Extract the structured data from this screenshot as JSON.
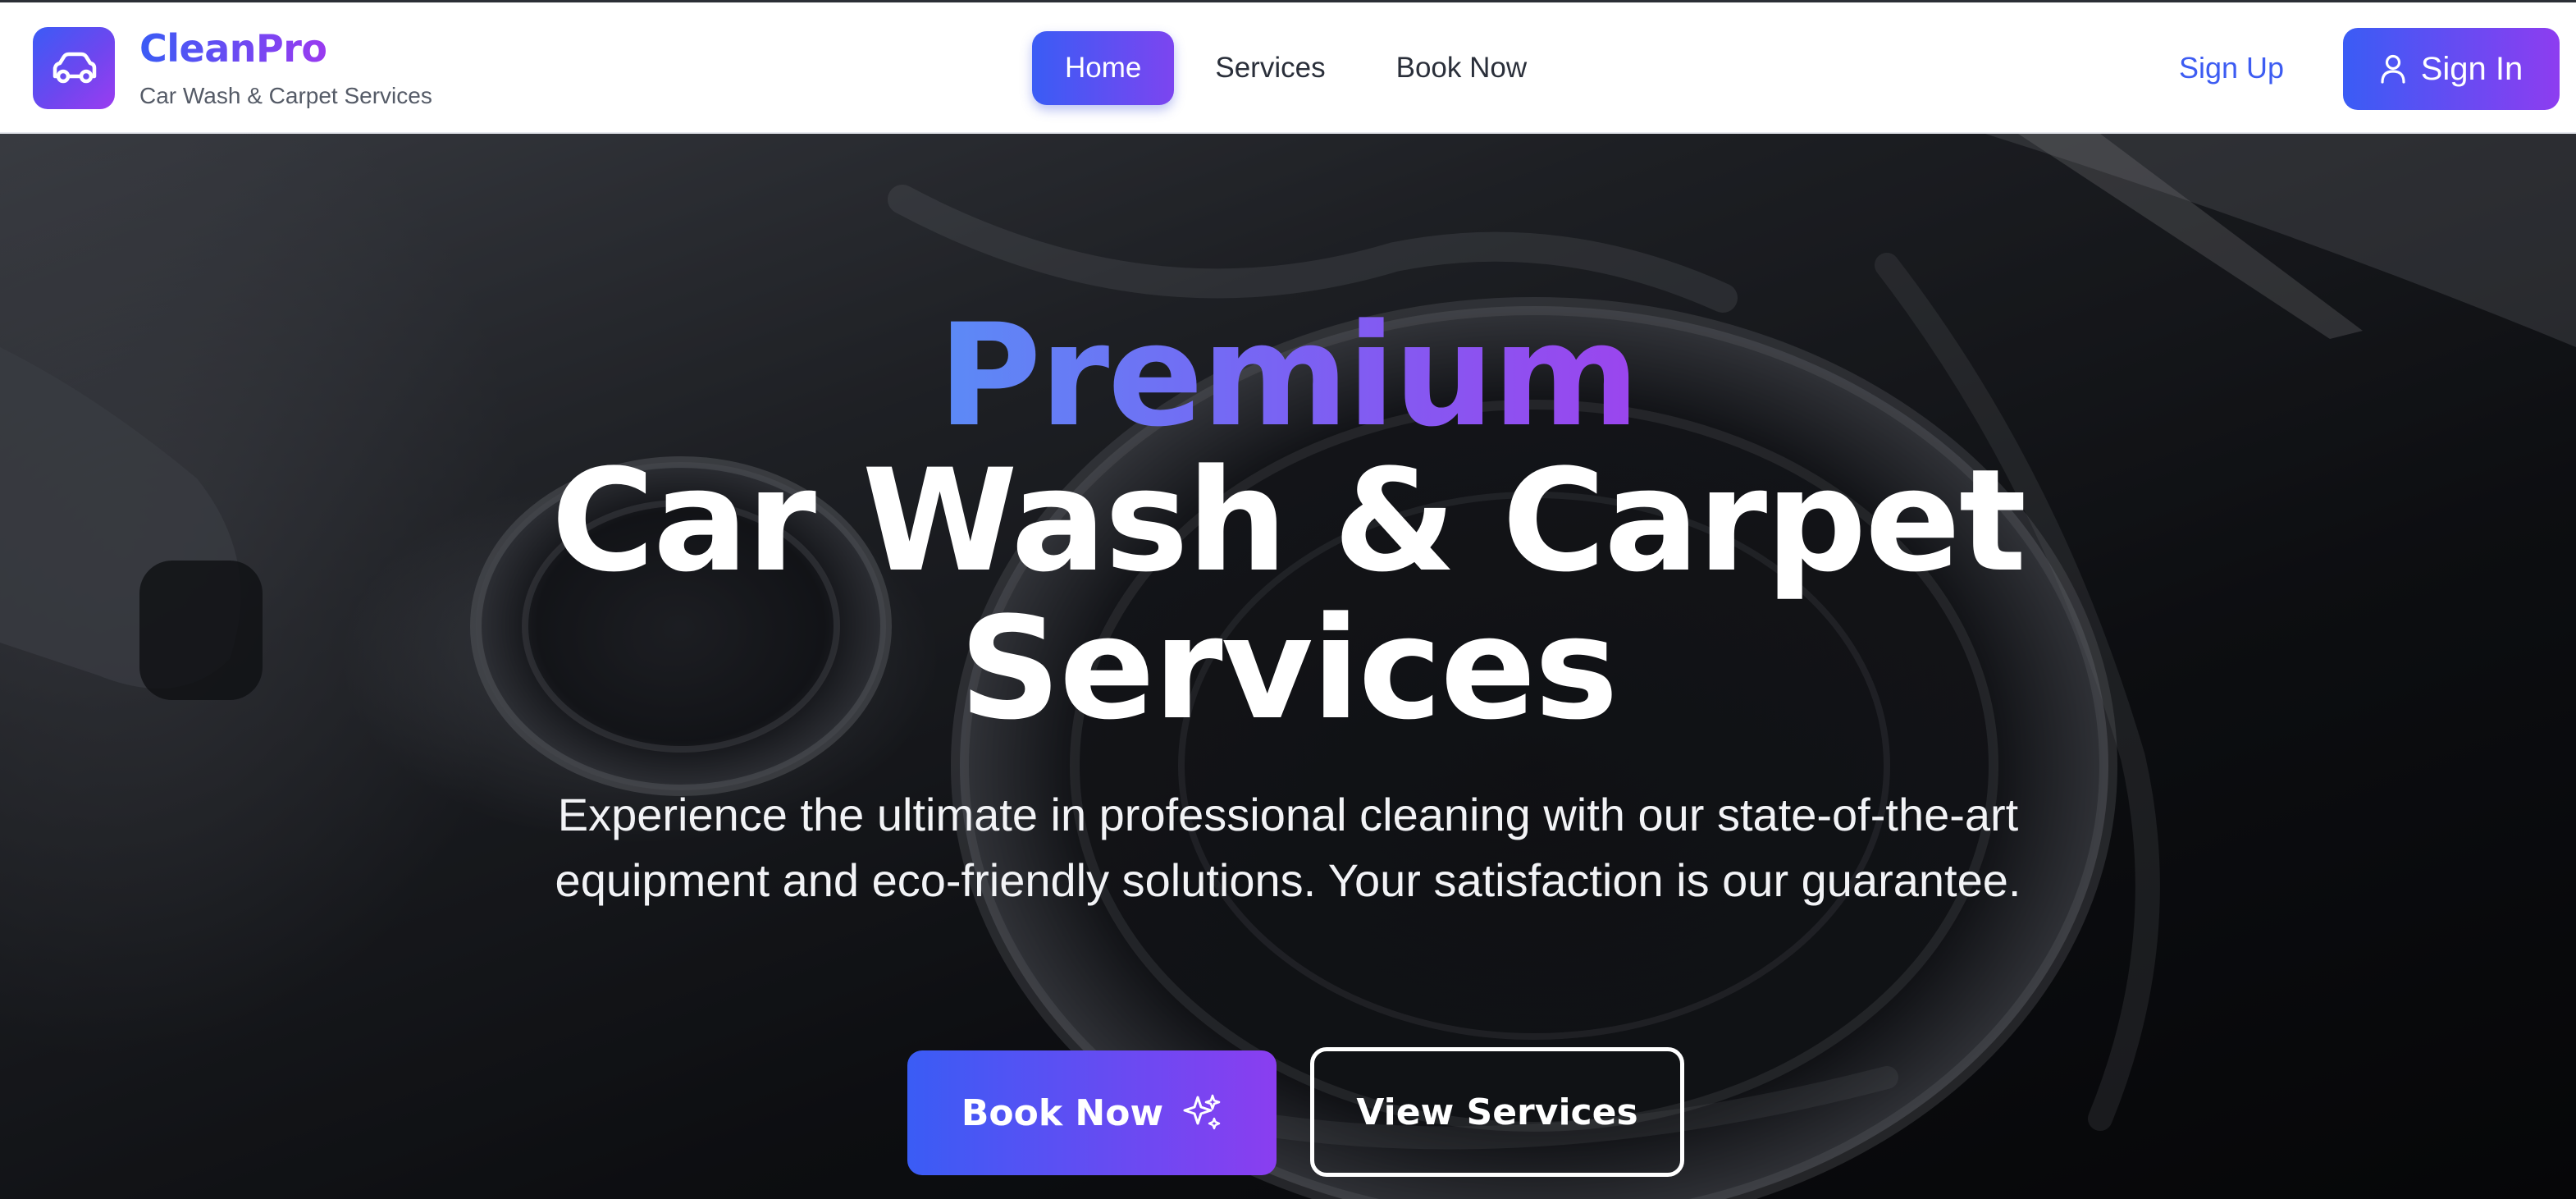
{
  "brand": {
    "name": "CleanPro",
    "tagline": "Car Wash & Carpet Services",
    "logo_icon": "car-icon"
  },
  "nav": {
    "items": [
      {
        "label": "Home",
        "active": true
      },
      {
        "label": "Services",
        "active": false
      },
      {
        "label": "Book Now",
        "active": false
      }
    ]
  },
  "auth": {
    "sign_up": "Sign Up",
    "sign_in": "Sign In",
    "sign_in_icon": "user-icon"
  },
  "hero": {
    "title_highlight": "Premium",
    "title_line1": "Car Wash & Carpet",
    "title_line2": "Services",
    "description": "Experience the ultimate in professional cleaning with our state-of-the-art equipment and eco-friendly solutions. Your satisfaction is our guarantee.",
    "primary_button": "Book Now",
    "primary_button_icon": "sparkles-icon",
    "secondary_button": "View Services"
  },
  "colors": {
    "accent_start": "#3a5cf5",
    "accent_end": "#9b3cf0",
    "header_bg": "#ffffff",
    "hero_text": "#ffffff"
  }
}
